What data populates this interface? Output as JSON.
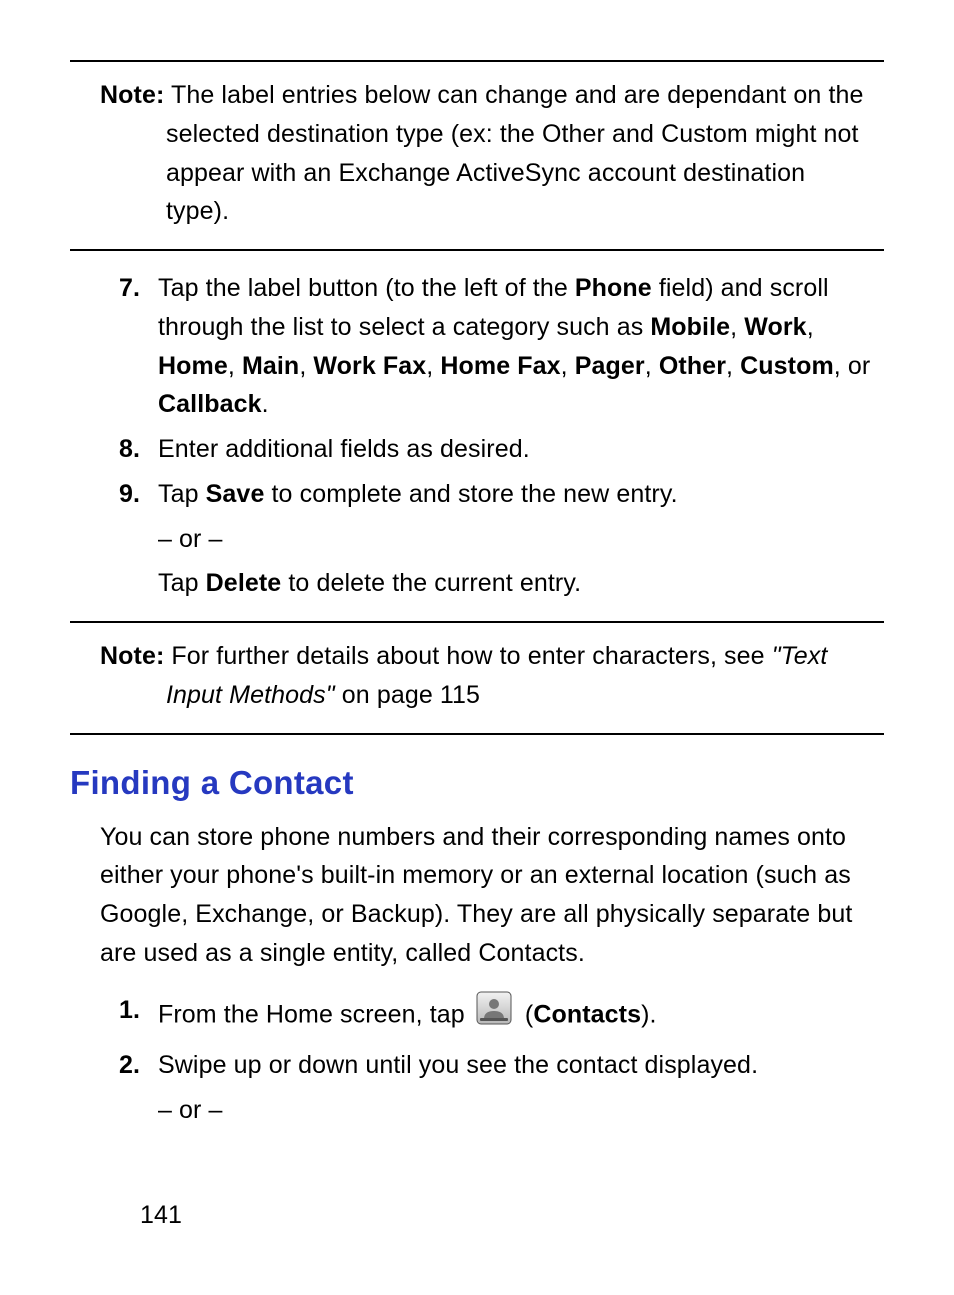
{
  "note1": {
    "label": "Note:",
    "text_a": " The label entries below can change and are dependant on the selected destination type (ex: the Other and Custom might not appear with an Exchange ActiveSync account destination type)."
  },
  "steps1": {
    "s7": {
      "num": "7.",
      "pre": "Tap the label button (to the left of the ",
      "b1": "Phone",
      "mid1": " field) and scroll through the list to select a category such as ",
      "b2": "Mobile",
      "c1": ", ",
      "b3": "Work",
      "c2": ", ",
      "b4": "Home",
      "c3": ", ",
      "b5": "Main",
      "c4": ", ",
      "b6": "Work Fax",
      "c5": ", ",
      "b7": "Home Fax",
      "c6": ", ",
      "b8": "Pager",
      "c7": ", ",
      "b9": "Other",
      "c8": ", ",
      "b10": "Custom",
      "c9": ", or ",
      "b11": "Callback",
      "end": "."
    },
    "s8": {
      "num": "8.",
      "text": "Enter additional fields as desired."
    },
    "s9": {
      "num": "9.",
      "pre": "Tap ",
      "b1": "Save",
      "mid": " to complete and store the new entry.",
      "or": "– or –",
      "pre2": "Tap ",
      "b2": "Delete",
      "end": " to delete the current entry."
    }
  },
  "note2": {
    "label": "Note:",
    "pre": " For further details about how to enter characters, see ",
    "ref": "\"Text Input Methods\"",
    "end": " on page 115"
  },
  "heading": "Finding a Contact",
  "intro": "You can store phone numbers and their corresponding names onto either your phone's built-in memory or an external location (such as Google, Exchange, or Backup). They are all physically separate but are used as a single entity, called Contacts.",
  "steps2": {
    "s1": {
      "num": "1.",
      "pre": "From the Home screen, tap ",
      "paren_open": " (",
      "b1": "Contacts",
      "paren_close": ")."
    },
    "s2": {
      "num": "2.",
      "text": "Swipe up or down until you see the contact displayed.",
      "or": "– or –"
    }
  },
  "page_number": "141"
}
